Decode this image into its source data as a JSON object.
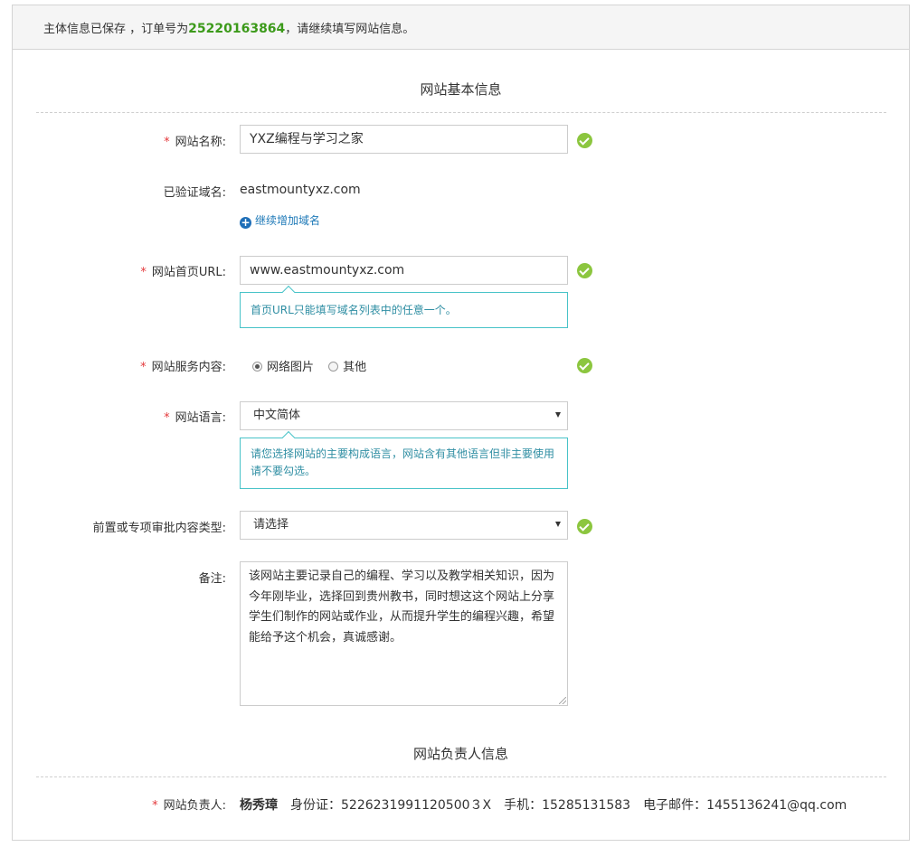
{
  "banner": {
    "text_before": "主体信息已保存 ，订单号为",
    "order_number": "25220163864",
    "text_after": "，请继续填写网站信息。"
  },
  "basic_section": {
    "title": "网站基本信息"
  },
  "fields": {
    "site_name": {
      "label": "网站名称:",
      "value": "YXZ编程与学习之家"
    },
    "verified_domain": {
      "label": "已验证域名:",
      "value": "eastmountyxz.com",
      "add_label": "继续增加域名"
    },
    "home_url": {
      "label": "网站首页URL:",
      "value": "www.eastmountyxz.com",
      "tip": "首页URL只能填写域名列表中的任意一个。"
    },
    "service_content": {
      "label": "网站服务内容:",
      "options": [
        "网络图片",
        "其他"
      ],
      "selected": "网络图片"
    },
    "language": {
      "label": "网站语言:",
      "value": "中文简体",
      "tip": "请您选择网站的主要构成语言，网站含有其他语言但非主要使用请不要勾选。"
    },
    "approval_type": {
      "label": "前置或专项审批内容类型:",
      "value": "请选择"
    },
    "remarks": {
      "label": "备注:",
      "value": "该网站主要记录自己的编程、学习以及教学相关知识，因为今年刚毕业，选择回到贵州教书，同时想这这个网站上分享学生们制作的网站或作业，从而提升学生的编程兴趣，希望能给予这个机会，真诚感谢。"
    }
  },
  "owner_section": {
    "title": "网站负责人信息",
    "label": "网站负责人:",
    "name": "杨秀璋",
    "id_card": "身份证：5226231991120500３X",
    "phone": "手机：15285131583",
    "email": "电子邮件：1455136241@qq.com"
  },
  "required_mark": "*",
  "colors": {
    "accent_green": "#8cc63f",
    "order_green": "#3c9a1a",
    "required_red": "#e4393c",
    "tip_border": "#48c3c8",
    "link_blue": "#1f7ab8"
  }
}
